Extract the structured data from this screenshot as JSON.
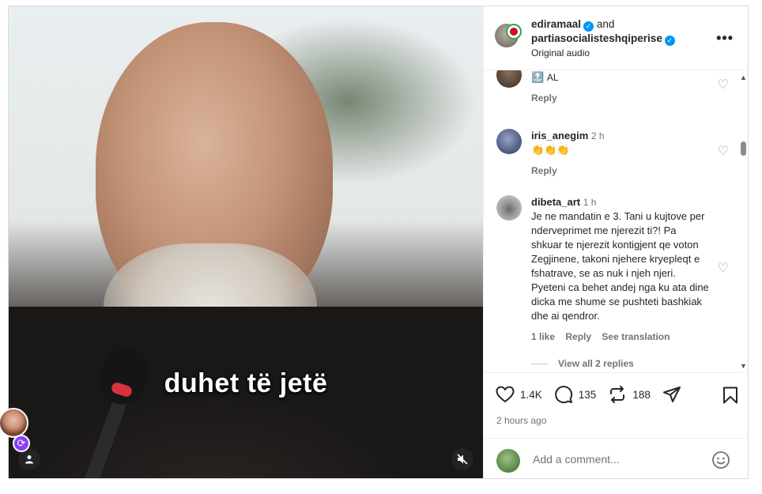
{
  "video": {
    "subtitle": "duhet të jetë"
  },
  "post_header": {
    "author1": "ediramaal",
    "and_text": "and",
    "author2": "partiasocialisteshqiperise",
    "audio": "Original audio",
    "more": "•••"
  },
  "comments": [
    {
      "username": "",
      "time": "",
      "text": "AL",
      "flag_glyph": "🔝",
      "reply": "Reply"
    },
    {
      "username": "iris_anegim",
      "time": "2 h",
      "text": "👏👏👏",
      "reply": "Reply"
    },
    {
      "username": "dibeta_art",
      "time": "1 h",
      "text": "Je ne mandatin e 3. Tani u kujtove per nderveprimet me njerezit ti?! Pa shkuar te njerezit kontigjent qe voton Zegjinene, takoni njehere kryepleqt e fshatrave, se as nuk i njeh njeri. Pyeteni ca behet andej nga ku ata dine dicka me shume se pushteti bashkiak dhe ai qendror.",
      "likes": "1 like",
      "reply": "Reply",
      "translate": "See translation",
      "view_replies": "View all 2 replies"
    }
  ],
  "footer": {
    "likes_count": "1.4K",
    "comments_count": "135",
    "reposts_count": "188",
    "posted": "2 hours ago",
    "add_comment_placeholder": "Add a comment..."
  },
  "colors": {
    "verified": "#0095f6",
    "text": "#262626",
    "muted": "#737373"
  }
}
